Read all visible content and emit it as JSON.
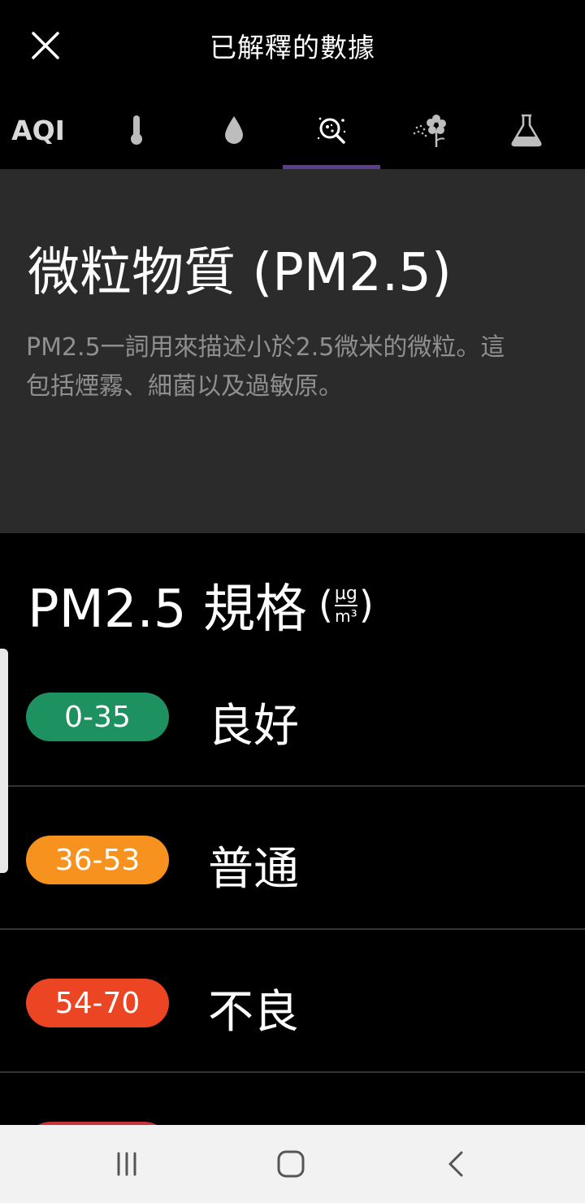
{
  "header": {
    "title": "已解釋的數據"
  },
  "tabs": {
    "aqi_label": "AQI",
    "items": [
      {
        "id": "aqi",
        "icon": "aqi-text"
      },
      {
        "id": "temperature",
        "icon": "thermometer-icon"
      },
      {
        "id": "humidity",
        "icon": "water-drop-icon"
      },
      {
        "id": "particulate",
        "icon": "particle-magnifier-icon"
      },
      {
        "id": "pollen",
        "icon": "pollen-flower-icon"
      },
      {
        "id": "chemical",
        "icon": "flask-icon"
      }
    ],
    "active": "particulate",
    "indicator_color": "#5b3f8f"
  },
  "info": {
    "title": "微粒物質 (PM2.5)",
    "description": "PM2.5一詞用來描述小於2.5微米的微粒。這包括煙霧、細菌以及過敏原。"
  },
  "spec": {
    "title": "PM2.5 規格",
    "unit_top": "µg",
    "unit_bottom": "m³",
    "paren_open": "(",
    "paren_close": ")"
  },
  "levels": [
    {
      "range": "0-35",
      "label": "良好",
      "color": "#1e9160"
    },
    {
      "range": "36-53",
      "label": "普通",
      "color": "#f7921e"
    },
    {
      "range": "54-70",
      "label": "不良",
      "color": "#ec4523"
    }
  ],
  "next_level_color": "#c8323a",
  "navbar": {
    "buttons": [
      "recent-apps-icon",
      "home-icon",
      "back-icon"
    ]
  }
}
